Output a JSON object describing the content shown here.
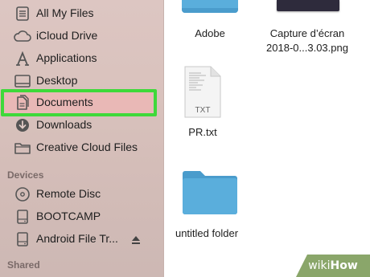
{
  "sidebar": {
    "favorites": [
      {
        "label": "All My Files",
        "icon": "all-files-icon"
      },
      {
        "label": "iCloud Drive",
        "icon": "cloud-icon"
      },
      {
        "label": "Applications",
        "icon": "applications-icon"
      },
      {
        "label": "Desktop",
        "icon": "desktop-icon"
      },
      {
        "label": "Documents",
        "icon": "documents-icon",
        "selected": true
      },
      {
        "label": "Downloads",
        "icon": "downloads-icon"
      },
      {
        "label": "Creative Cloud Files",
        "icon": "folder-icon"
      }
    ],
    "devices_header": "Devices",
    "devices": [
      {
        "label": "Remote Disc",
        "icon": "disc-icon"
      },
      {
        "label": "BOOTCAMP",
        "icon": "drive-icon"
      },
      {
        "label": "Android File Tr...",
        "icon": "drive-icon",
        "eject": true
      }
    ],
    "shared_header": "Shared"
  },
  "files": [
    {
      "name": "Adobe",
      "kind": "folder"
    },
    {
      "name": "Capture d’écran 2018-0...3.03.png",
      "name_line1": "Capture d’écran",
      "name_line2": "2018-0...3.03.png",
      "kind": "image"
    },
    {
      "name": "PR.txt",
      "kind": "text",
      "badge": "TXT"
    },
    {
      "name": "untitled folder",
      "kind": "folder"
    }
  ],
  "watermark": {
    "wiki": "wiki",
    "how": "How"
  },
  "colors": {
    "highlight": "#3fd93a",
    "selection": "#e9b8b6",
    "folder": "#5aaedc",
    "sidebar": "#d9c2bd"
  }
}
